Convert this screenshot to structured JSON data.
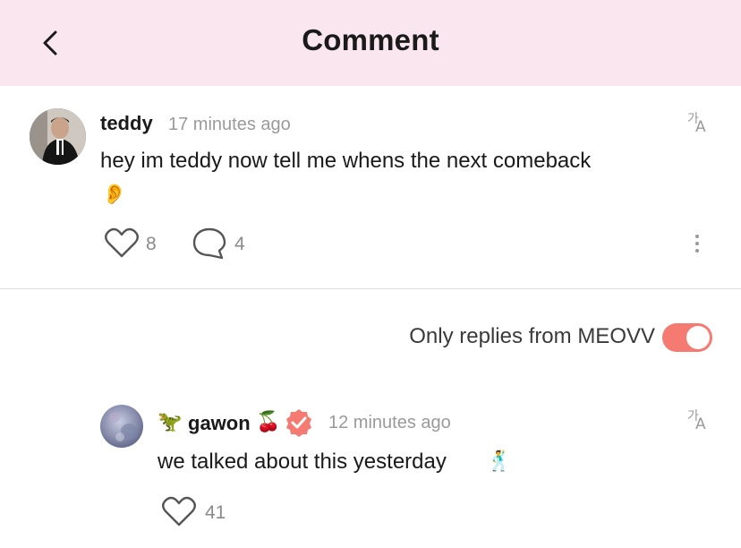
{
  "header": {
    "title": "Comment",
    "back_icon": "chevron-left-icon"
  },
  "comment": {
    "username": "teddy",
    "time": "17 minutes ago",
    "text": "hey im teddy now tell me whens the next comeback",
    "emoji": "👂",
    "like_count": "8",
    "reply_count": "4"
  },
  "filter": {
    "label": "Only replies from MEOVV",
    "enabled": true,
    "accent_color": "#f47a72"
  },
  "reply": {
    "prefix_emoji": "🦖",
    "username": "gawon",
    "suffix_emoji": "🍒",
    "verified": true,
    "time": "12 minutes ago",
    "text": "we talked about this yesterday",
    "text_emoji": "🕺",
    "like_count": "41"
  },
  "translate": {
    "line1": "가",
    "line2": "A"
  },
  "colors": {
    "header_bg": "#f9e6ee",
    "badge": "#f47a72"
  }
}
